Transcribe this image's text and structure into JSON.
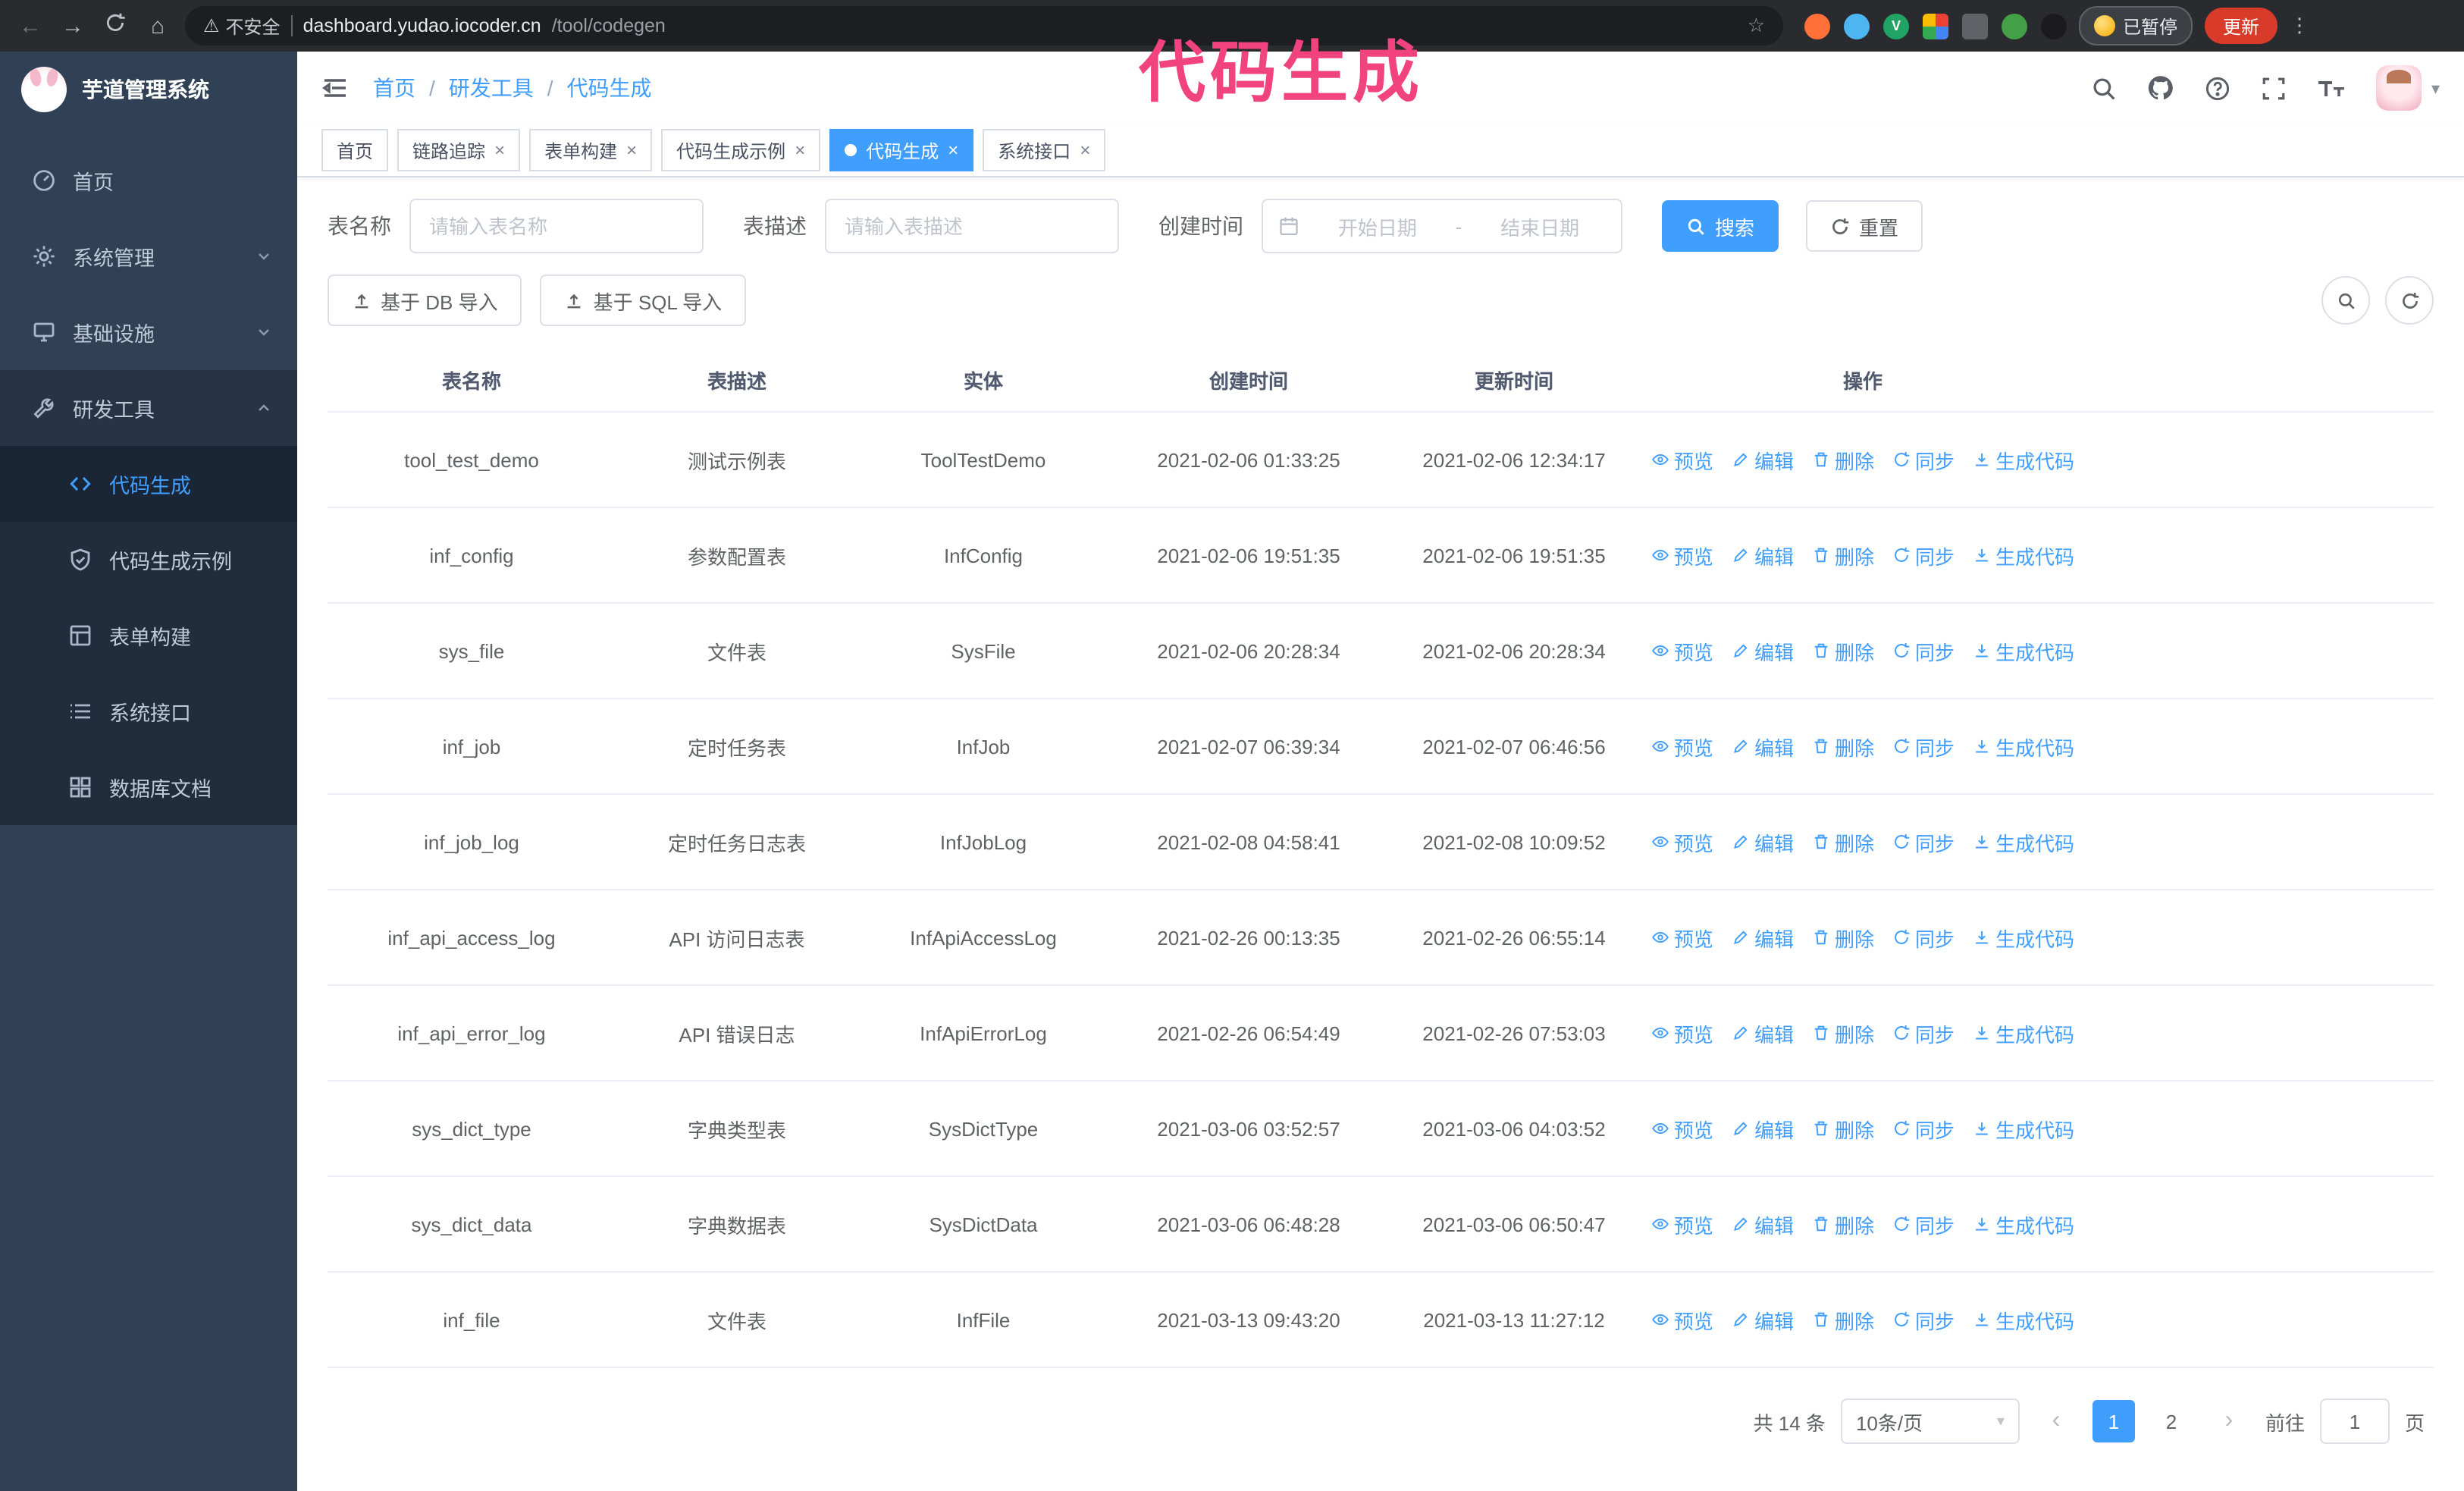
{
  "browser": {
    "security": "不安全",
    "url_domain": "dashboard.yudao.iocoder.cn",
    "url_path": "/tool/codegen",
    "paused_badge": "已暂停",
    "update_button": "更新"
  },
  "annotation": {
    "text": "代码生成",
    "color": "#f1437e"
  },
  "sidebar": {
    "title": "芋道管理系统",
    "items": [
      {
        "label": "首页",
        "icon": "dashboard-icon",
        "expandable": false
      },
      {
        "label": "系统管理",
        "icon": "gear-icon",
        "expandable": true,
        "expanded": false
      },
      {
        "label": "基础设施",
        "icon": "infrastructure-icon",
        "expandable": true,
        "expanded": false
      },
      {
        "label": "研发工具",
        "icon": "tool-icon",
        "expandable": true,
        "expanded": true,
        "children": [
          {
            "label": "代码生成",
            "icon": "code-icon",
            "active": true
          },
          {
            "label": "代码生成示例",
            "icon": "example-check-icon",
            "active": false
          },
          {
            "label": "表单构建",
            "icon": "form-icon",
            "active": false
          },
          {
            "label": "系统接口",
            "icon": "api-icon",
            "active": false
          },
          {
            "label": "数据库文档",
            "icon": "database-icon",
            "active": false
          }
        ]
      }
    ]
  },
  "navbar": {
    "breadcrumb": [
      "首页",
      "研发工具",
      "代码生成"
    ]
  },
  "tabs": [
    {
      "label": "首页",
      "closable": false,
      "active": false
    },
    {
      "label": "链路追踪",
      "closable": true,
      "active": false
    },
    {
      "label": "表单构建",
      "closable": true,
      "active": false
    },
    {
      "label": "代码生成示例",
      "closable": true,
      "active": false
    },
    {
      "label": "代码生成",
      "closable": true,
      "active": true
    },
    {
      "label": "系统接口",
      "closable": true,
      "active": false
    }
  ],
  "filters": {
    "table_name_label": "表名称",
    "table_name_placeholder": "请输入表名称",
    "table_desc_label": "表描述",
    "table_desc_placeholder": "请输入表描述",
    "create_time_label": "创建时间",
    "date_start_placeholder": "开始日期",
    "date_separator": "-",
    "date_end_placeholder": "结束日期",
    "search_button": "搜索",
    "reset_button": "重置"
  },
  "toolbar": {
    "import_db_button": "基于 DB 导入",
    "import_sql_button": "基于 SQL 导入"
  },
  "table": {
    "columns": [
      "表名称",
      "表描述",
      "实体",
      "创建时间",
      "更新时间",
      "操作"
    ],
    "operations": [
      "预览",
      "编辑",
      "删除",
      "同步",
      "生成代码"
    ],
    "rows": [
      {
        "name": "tool_test_demo",
        "desc": "测试示例表",
        "entity": "ToolTestDemo",
        "created": "2021-02-06 01:33:25",
        "updated": "2021-02-06 12:34:17"
      },
      {
        "name": "inf_config",
        "desc": "参数配置表",
        "entity": "InfConfig",
        "created": "2021-02-06 19:51:35",
        "updated": "2021-02-06 19:51:35"
      },
      {
        "name": "sys_file",
        "desc": "文件表",
        "entity": "SysFile",
        "created": "2021-02-06 20:28:34",
        "updated": "2021-02-06 20:28:34"
      },
      {
        "name": "inf_job",
        "desc": "定时任务表",
        "entity": "InfJob",
        "created": "2021-02-07 06:39:34",
        "updated": "2021-02-07 06:46:56"
      },
      {
        "name": "inf_job_log",
        "desc": "定时任务日志表",
        "entity": "InfJobLog",
        "created": "2021-02-08 04:58:41",
        "updated": "2021-02-08 10:09:52"
      },
      {
        "name": "inf_api_access_log",
        "desc": "API 访问日志表",
        "entity": "InfApiAccessLog",
        "created": "2021-02-26 00:13:35",
        "updated": "2021-02-26 06:55:14"
      },
      {
        "name": "inf_api_error_log",
        "desc": "API 错误日志",
        "entity": "InfApiErrorLog",
        "created": "2021-02-26 06:54:49",
        "updated": "2021-02-26 07:53:03"
      },
      {
        "name": "sys_dict_type",
        "desc": "字典类型表",
        "entity": "SysDictType",
        "created": "2021-03-06 03:52:57",
        "updated": "2021-03-06 04:03:52"
      },
      {
        "name": "sys_dict_data",
        "desc": "字典数据表",
        "entity": "SysDictData",
        "created": "2021-03-06 06:48:28",
        "updated": "2021-03-06 06:50:47"
      },
      {
        "name": "inf_file",
        "desc": "文件表",
        "entity": "InfFile",
        "created": "2021-03-13 09:43:20",
        "updated": "2021-03-13 11:27:12"
      }
    ]
  },
  "pagination": {
    "total": "共 14 条",
    "page_size": "10条/页",
    "pages": [
      "1",
      "2"
    ],
    "active_page": "1",
    "prev_icon": "‹",
    "next_icon": "›",
    "goto_label": "前往",
    "goto_value": "1",
    "goto_unit": "页"
  },
  "colors": {
    "accent": "#409EFF",
    "sidebar_bg": "#304156",
    "submenu_bg": "#1f2d3d",
    "active_tab_bg": "#409EFF",
    "update_button_bg": "#d93b2b",
    "annotation": "#f1437e"
  }
}
